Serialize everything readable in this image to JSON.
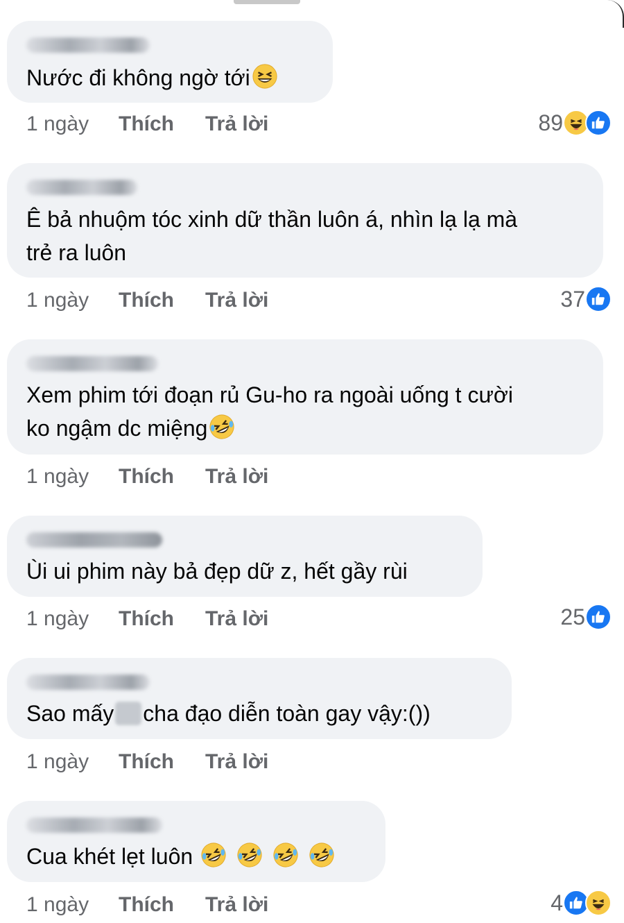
{
  "comments": [
    {
      "text": "Nước đi không ngờ tới",
      "time": "1 ngày",
      "like_label": "Thích",
      "reply_label": "Trả lời",
      "reaction_count": "89",
      "reactions": [
        "haha-icon",
        "like-icon"
      ]
    },
    {
      "text": "Ê bả nhuộm tóc xinh dữ thần luôn á, nhìn lạ lạ mà\ntrẻ ra luôn",
      "time": "1 ngày",
      "like_label": "Thích",
      "reply_label": "Trả lời",
      "reaction_count": "37",
      "reactions": [
        "like-icon"
      ]
    },
    {
      "text": "Xem phim tới đoạn rủ Gu-ho ra ngoài uống t cười\nko ngậm dc miệng",
      "time": "1 ngày",
      "like_label": "Thích",
      "reply_label": "Trả lời",
      "reaction_count": "",
      "reactions": []
    },
    {
      "text": "Ùi ui phim này bả đẹp dữ z, hết gầy rùi",
      "time": "1 ngày",
      "like_label": "Thích",
      "reply_label": "Trả lời",
      "reaction_count": "25",
      "reactions": [
        "like-icon"
      ]
    },
    {
      "text_before": "Sao mấy",
      "text_after": "cha đạo diễn toàn gay vậy:())",
      "time": "1 ngày",
      "like_label": "Thích",
      "reply_label": "Trả lời",
      "reaction_count": "",
      "reactions": []
    },
    {
      "text": "Cua khét lẹt luôn",
      "time": "1 ngày",
      "like_label": "Thích",
      "reply_label": "Trả lời",
      "reaction_count": "4",
      "reactions": [
        "like-icon",
        "haha-icon"
      ]
    }
  ],
  "colors": {
    "bubble": "#f0f2f5",
    "meta_text": "#65676b",
    "like_blue": "#1877f2",
    "emoji_yellow": "#f7c945"
  }
}
